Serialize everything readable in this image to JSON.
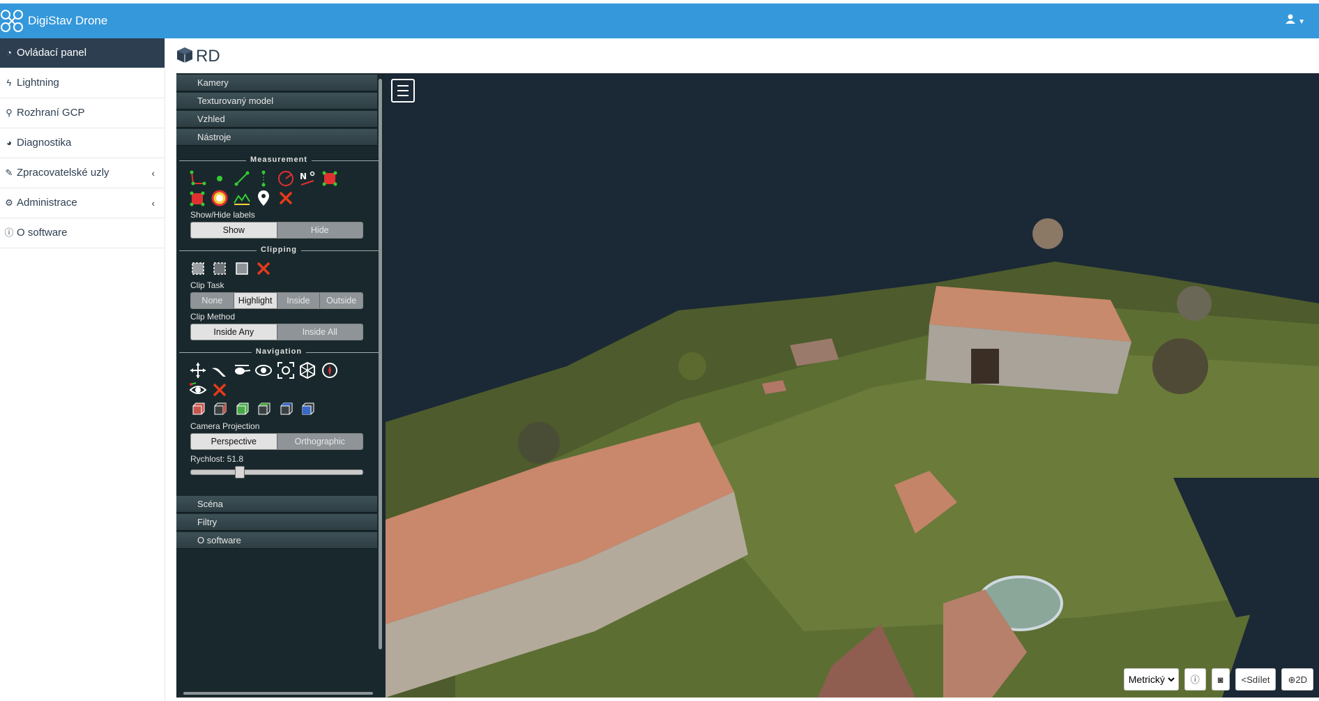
{
  "app": {
    "title": "DigiStav Drone"
  },
  "colors": {
    "topbar": "#3498db",
    "sidebar_active": "#2c3e50",
    "viewer_bg": "#1a2733"
  },
  "sidebar": {
    "items": [
      {
        "label": "Ovládací panel",
        "icon": "dashboard-icon",
        "active": true
      },
      {
        "label": "Lightning",
        "icon": "bolt-icon"
      },
      {
        "label": "Rozhraní GCP",
        "icon": "map-marker-icon"
      },
      {
        "label": "Diagnostika",
        "icon": "pie-chart-icon"
      },
      {
        "label": "Zpracovatelské uzly",
        "icon": "wrench-icon",
        "expandable": true
      },
      {
        "label": "Administrace",
        "icon": "gears-icon",
        "expandable": true
      },
      {
        "label": "O software",
        "icon": "info-icon"
      }
    ]
  },
  "page": {
    "title": "RD"
  },
  "panel": {
    "accordion_top": [
      "Kamery",
      "Texturovaný model",
      "Vzhled",
      "Nástroje"
    ],
    "measurement": {
      "title": "Measurement",
      "labels_caption": "Show/Hide labels",
      "show": "Show",
      "hide": "Hide"
    },
    "clipping": {
      "title": "Clipping",
      "task_caption": "Clip Task",
      "tasks": [
        "None",
        "Highlight",
        "Inside",
        "Outside"
      ],
      "method_caption": "Clip Method",
      "methods": [
        "Inside Any",
        "Inside All"
      ]
    },
    "navigation": {
      "title": "Navigation",
      "projection_caption": "Camera Projection",
      "projections": [
        "Perspective",
        "Orthographic"
      ],
      "speed_label": "Rychlost: 51.8",
      "speed_fraction": 0.27
    },
    "accordion_bottom": [
      "Scéna",
      "Filtry",
      "O software"
    ]
  },
  "toolbar": {
    "units_selected": "Metrický",
    "share_label": "Sdílet",
    "view2d_label": "2D"
  }
}
